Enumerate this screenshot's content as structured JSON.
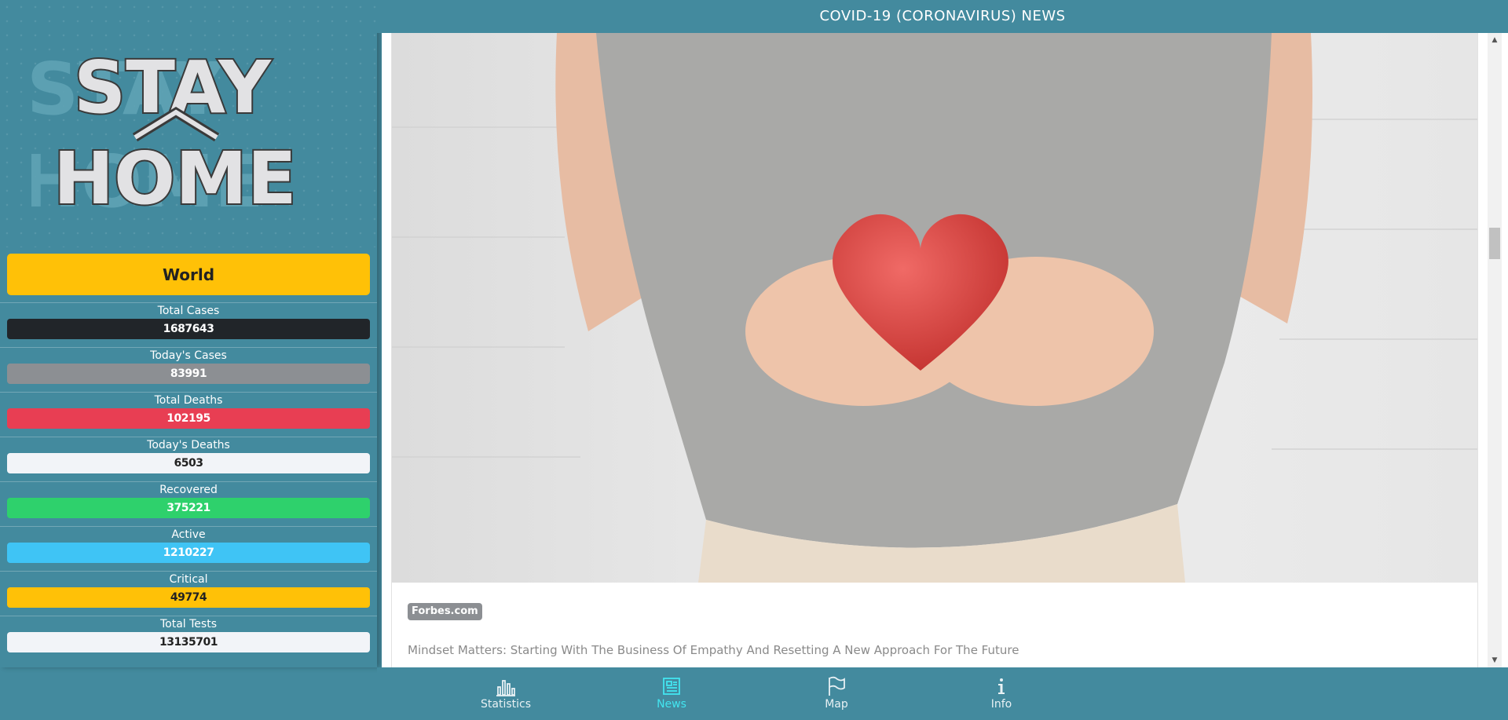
{
  "logo": {
    "line1": "STAY",
    "line2": "HOME"
  },
  "region_button": {
    "label": "World"
  },
  "stats": [
    {
      "label": "Total Cases",
      "value": "1687643",
      "color": "#212529",
      "text_color": "#ffffff"
    },
    {
      "label": "Today's Cases",
      "value": "83991",
      "color": "#8c8f93",
      "text_color": "#ffffff"
    },
    {
      "label": "Total Deaths",
      "value": "102195",
      "color": "#e83e53",
      "text_color": "#ffffff"
    },
    {
      "label": "Today's Deaths",
      "value": "6503",
      "color": "#f2f4f8",
      "text_color": "#222222"
    },
    {
      "label": "Recovered",
      "value": "375221",
      "color": "#2ed16c",
      "text_color": "#ffffff"
    },
    {
      "label": "Active",
      "value": "1210227",
      "color": "#3fc4f5",
      "text_color": "#ffffff"
    },
    {
      "label": "Critical",
      "value": "49774",
      "color": "#ffc107",
      "text_color": "#222222"
    },
    {
      "label": "Total Tests",
      "value": "13135701",
      "color": "#f2f4f8",
      "text_color": "#222222"
    }
  ],
  "header": {
    "title": "COVID-19 (CORONAVIRUS) NEWS"
  },
  "news": {
    "source": "Forbes.com",
    "title": "Mindset Matters: Starting With The Business Of Empathy And Resetting A New Approach For The Future"
  },
  "nav": {
    "items": [
      {
        "label": "Statistics",
        "icon": "bar-chart-icon",
        "active": false
      },
      {
        "label": "News",
        "icon": "newspaper-icon",
        "active": true
      },
      {
        "label": "Map",
        "icon": "flag-icon",
        "active": false
      },
      {
        "label": "Info",
        "icon": "info-icon",
        "active": false
      }
    ]
  },
  "colors": {
    "background": "#438a9e",
    "accent_active": "#43e5f0",
    "world_button": "#ffc107"
  }
}
